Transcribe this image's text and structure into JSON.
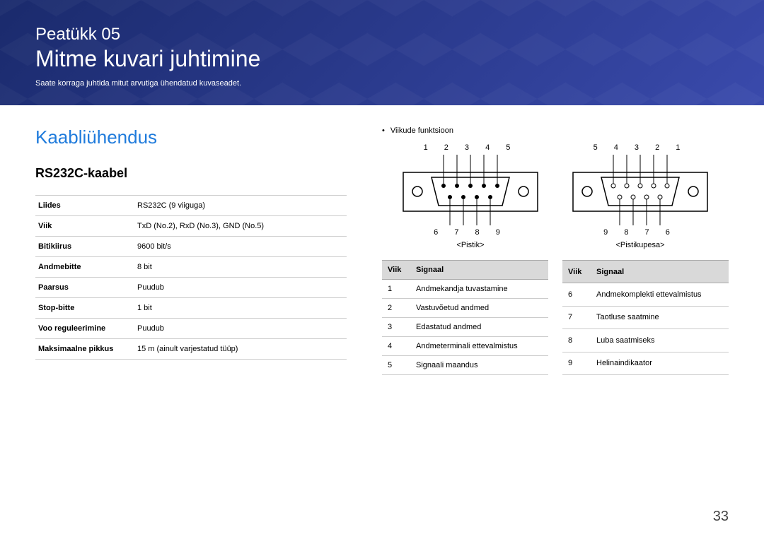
{
  "header": {
    "chapter_label": "Peatükk  05",
    "chapter_title": "Mitme kuvari juhtimine",
    "subtitle": "Saate korraga juhtida mitut arvutiga ühendatud kuvaseadet."
  },
  "section_title": "Kaabliühendus",
  "sub_title": "RS232C-kaabel",
  "spec_table": [
    {
      "label": "Liides",
      "value": "RS232C (9 viiguga)"
    },
    {
      "label": "Viik",
      "value": "TxD (No.2), RxD (No.3), GND (No.5)"
    },
    {
      "label": "Bitikiirus",
      "value": "9600 bit/s"
    },
    {
      "label": "Andmebitte",
      "value": "8 bit"
    },
    {
      "label": "Paarsus",
      "value": "Puudub"
    },
    {
      "label": "Stop-bitte",
      "value": "1 bit"
    },
    {
      "label": "Voo reguleerimine",
      "value": "Puudub"
    },
    {
      "label": "Maksimaalne pikkus",
      "value": "15 m (ainult varjestatud tüüp)"
    }
  ],
  "bullet_text": "Viikude funktsioon",
  "diagram": {
    "left": {
      "top_pins": "1 2 3 4 5",
      "bottom_pins": "6 7 8 9",
      "label": "<Pistik>"
    },
    "right": {
      "top_pins": "5 4 3 2 1",
      "bottom_pins": "9 8 7 6",
      "label": "<Pistikupesa>"
    }
  },
  "pin_table_headers": {
    "col1": "Viik",
    "col2": "Signaal"
  },
  "pin_table_left": [
    {
      "pin": "1",
      "signal": "Andmekandja tuvastamine"
    },
    {
      "pin": "2",
      "signal": "Vastuvõetud andmed"
    },
    {
      "pin": "3",
      "signal": "Edastatud andmed"
    },
    {
      "pin": "4",
      "signal": "Andmeterminali ettevalmistus"
    },
    {
      "pin": "5",
      "signal": "Signaali maandus"
    }
  ],
  "pin_table_right": [
    {
      "pin": "6",
      "signal": "Andmekomplekti ettevalmistus"
    },
    {
      "pin": "7",
      "signal": "Taotluse saatmine"
    },
    {
      "pin": "8",
      "signal": "Luba saatmiseks"
    },
    {
      "pin": "9",
      "signal": "Helinaindikaator"
    }
  ],
  "page_number": "33"
}
